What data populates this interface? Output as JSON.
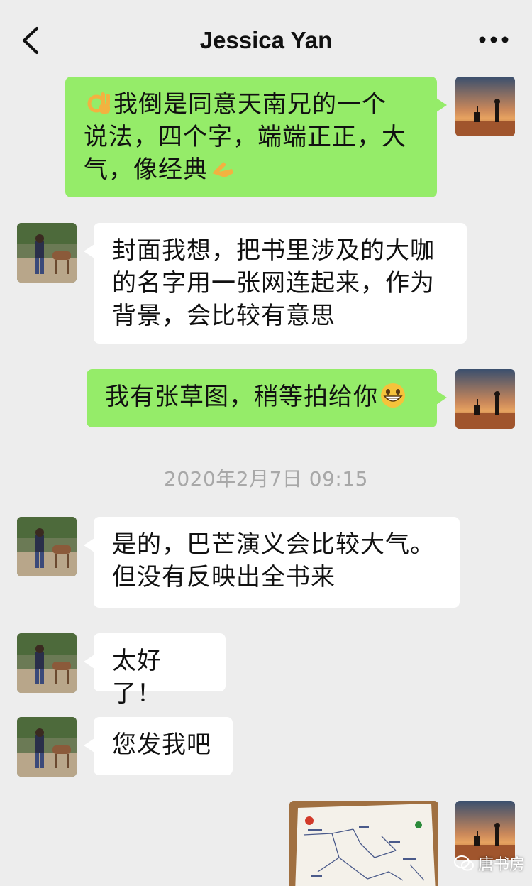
{
  "header": {
    "title": "Jessica Yan"
  },
  "messages": [
    {
      "side": "right",
      "text": "我倒是同意天南兄的一个说法，四个字，端端正正，大气，像经典",
      "emoji_lead": "ok-hand",
      "emoji_tail": "pointing-hand"
    },
    {
      "side": "left",
      "text": "封面我想，把书里涉及的大咖的名字用一张网连起来，作为背景，会比较有意思"
    },
    {
      "side": "right",
      "text": "我有张草图，稍等拍给你",
      "emoji_tail": "grinning-face"
    },
    {
      "side": "left",
      "text": "是的，巴芒演义会比较大气。但没有反映出全书来"
    },
    {
      "side": "left",
      "text": "太好了！"
    },
    {
      "side": "left",
      "text": "您发我吧"
    },
    {
      "side": "right",
      "type": "image",
      "content": "sketch-photo"
    }
  ],
  "m1": {
    "line1": "我倒是同意天南兄的一个",
    "line2": "说法，四个字，端端正正，大",
    "line3": "气，像经典"
  },
  "m2": {
    "line1": "封面我想，把书里涉及的大咖",
    "line2": "的名字用一张网连起来，作为",
    "line3": "背景，会比较有意思"
  },
  "m3": {
    "line1": "我有张草图，稍等拍给你"
  },
  "timestamp": "2020年2月7日 09:15",
  "m4": {
    "line1": "是的，巴芒演义会比较大气。",
    "line2": "但没有反映出全书来"
  },
  "m5": {
    "line1": "太好了！"
  },
  "m6": {
    "line1": "您发我吧"
  },
  "watermark": "唐书房",
  "colors": {
    "background": "#ededed",
    "bubble_sent": "#95ec69",
    "bubble_received": "#ffffff",
    "timestamp": "#a8a8a8"
  }
}
